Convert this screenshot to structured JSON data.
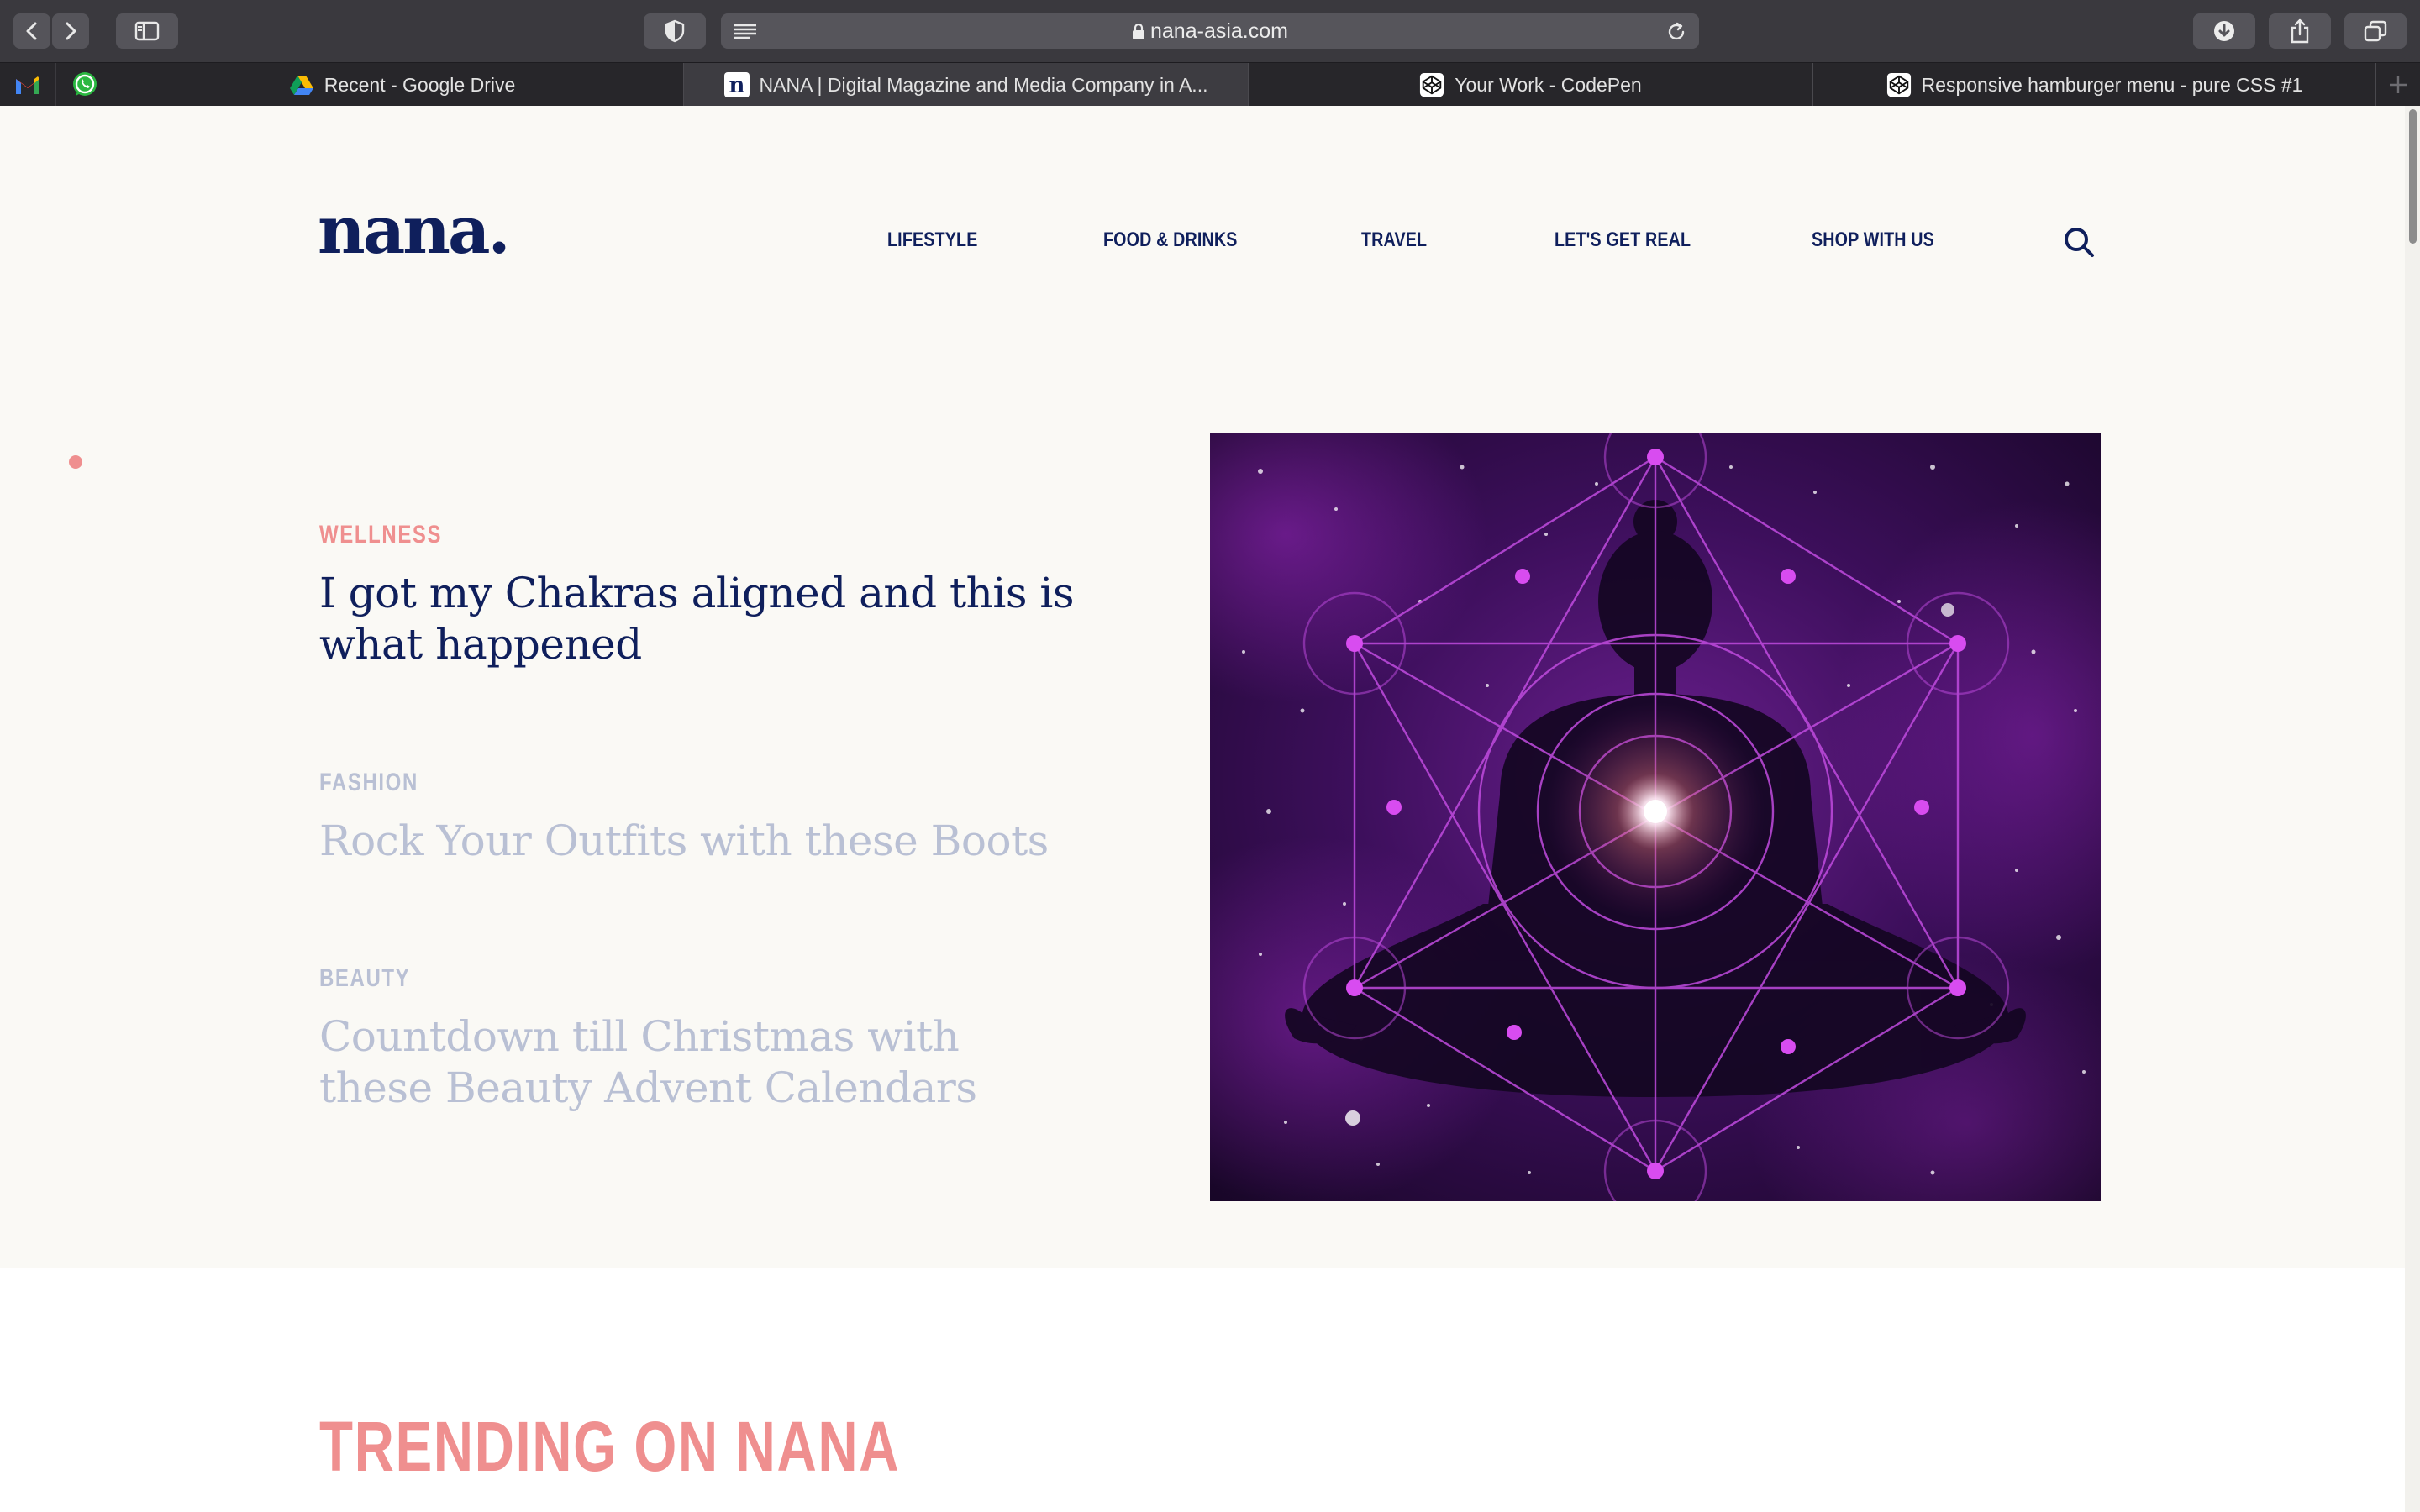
{
  "browser": {
    "url": "nana-asia.com",
    "tabs": [
      {
        "title": "Recent - Google Drive",
        "icon": "google-drive-icon"
      },
      {
        "title": "NANA | Digital Magazine and Media Company in A...",
        "icon": "nana-favicon",
        "active": true
      },
      {
        "title": "Your Work - CodePen",
        "icon": "codepen-icon"
      },
      {
        "title": "Responsive hamburger menu - pure CSS #1",
        "icon": "codepen-icon"
      }
    ],
    "pinned": [
      "gmail-icon",
      "whatsapp-icon"
    ]
  },
  "site": {
    "logo": "nana.",
    "nav": [
      "LIFESTYLE",
      "FOOD & DRINKS",
      "TRAVEL",
      "LET'S GET REAL",
      "SHOP WITH US"
    ],
    "stories": [
      {
        "category": "WELLNESS",
        "title": "I got my Chakras aligned and this is what happened",
        "active": true
      },
      {
        "category": "FASHION",
        "title": "Rock Your Outfits with these Boots",
        "active": false
      },
      {
        "category": "BEAUTY",
        "title": "Countdown till Christmas with these Beauty Advent Calendars",
        "active": false
      }
    ],
    "trending_heading": "TRENDING ON NANA"
  },
  "colors": {
    "navy": "#0f1f5c",
    "coral": "#ef8f8f",
    "muted": "#b9c0d4",
    "background": "#faf9f5"
  }
}
